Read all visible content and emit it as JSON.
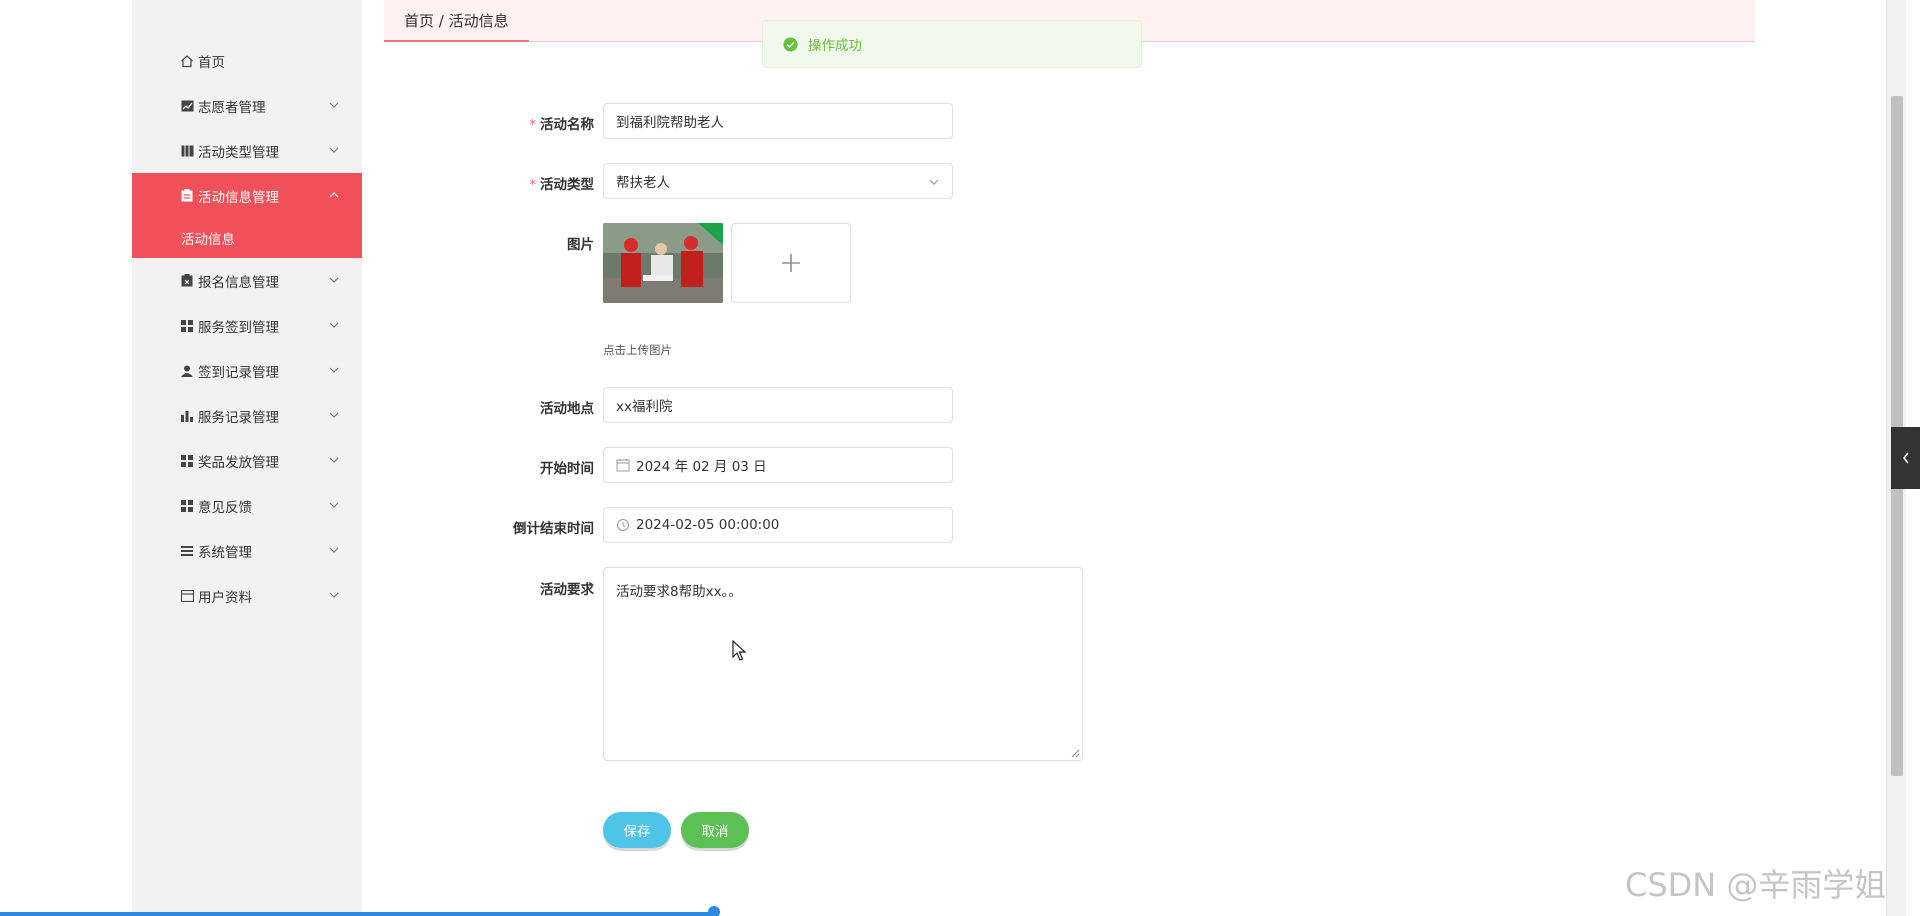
{
  "sidebar": {
    "items": [
      {
        "label": "首页",
        "icon": "home-icon"
      },
      {
        "label": "志愿者管理",
        "icon": "chart-icon"
      },
      {
        "label": "活动类型管理",
        "icon": "book-icon"
      },
      {
        "label": "活动信息管理",
        "icon": "clipboard-icon",
        "active": true,
        "children": [
          {
            "label": "活动信息"
          }
        ]
      },
      {
        "label": "报名信息管理",
        "icon": "file-icon"
      },
      {
        "label": "服务签到管理",
        "icon": "grid-icon"
      },
      {
        "label": "签到记录管理",
        "icon": "user-icon"
      },
      {
        "label": "服务记录管理",
        "icon": "bar-chart-icon"
      },
      {
        "label": "奖品发放管理",
        "icon": "grid-icon"
      },
      {
        "label": "意见反馈",
        "icon": "grid-icon"
      },
      {
        "label": "系统管理",
        "icon": "list-icon"
      },
      {
        "label": "用户资料",
        "icon": "card-icon"
      }
    ],
    "active_color": "#f0505a"
  },
  "breadcrumb": {
    "text": "首页 / 活动信息"
  },
  "toast": {
    "message": "操作成功",
    "color": "#67c23a"
  },
  "form": {
    "name": {
      "label": "活动名称",
      "value": "到福利院帮助老人",
      "required": true
    },
    "type": {
      "label": "活动类型",
      "value": "帮扶老人",
      "required": true
    },
    "image": {
      "label": "图片",
      "hint": "点击上传图片"
    },
    "location": {
      "label": "活动地点",
      "value": "xx福利院"
    },
    "start_time": {
      "label": "开始时间",
      "value": "2024 年 02 月 03 日"
    },
    "end_time": {
      "label": "倒计结束时间",
      "value": "2024-02-05 00:00:00"
    },
    "requirements": {
      "label": "活动要求",
      "value": "活动要求8帮助xx。。"
    }
  },
  "buttons": {
    "save": "保存",
    "cancel": "取消"
  },
  "watermark": "CSDN @辛雨学姐"
}
